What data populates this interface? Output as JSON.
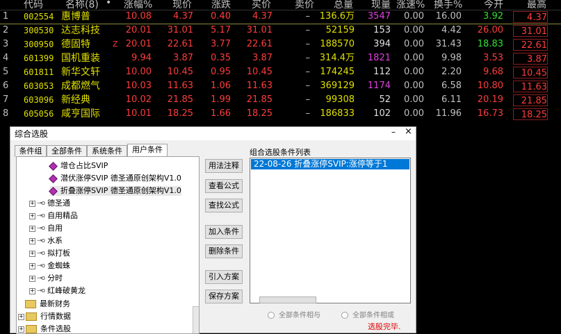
{
  "quote_table": {
    "headers": [
      "代码",
      "名称(8)",
      "•",
      "涨幅%",
      "现价",
      "涨跌",
      "买价",
      "卖价",
      "总量",
      "现量",
      "涨速%",
      "换手%",
      "今开",
      "最高"
    ],
    "rows": [
      {
        "idx": "1",
        "code": "002554",
        "name": "惠博普",
        "mark": "",
        "pct": "10.08",
        "price": "4.37",
        "chg": "0.40",
        "bid": "4.37",
        "ask": "–",
        "vol": "136.6万",
        "cur": "3547",
        "cur_color": "#e040e0",
        "spd": "0.00",
        "turn": "16.00",
        "open": "3.92",
        "open_color": "#30e030",
        "high": "4.37"
      },
      {
        "idx": "2",
        "code": "300530",
        "name": "达志科技",
        "mark": "",
        "pct": "20.01",
        "price": "31.01",
        "chg": "5.17",
        "bid": "31.01",
        "ask": "–",
        "vol": "52159",
        "cur": "153",
        "cur_color": "#e0e0e0",
        "spd": "0.00",
        "turn": "4.42",
        "open": "26.00",
        "open_color": "#ff3c3c",
        "high": "31.01"
      },
      {
        "idx": "3",
        "code": "300950",
        "name": "德固特",
        "mark": "Z",
        "pct": "20.01",
        "price": "22.61",
        "chg": "3.77",
        "bid": "22.61",
        "ask": "–",
        "vol": "188570",
        "cur": "394",
        "cur_color": "#e0e0e0",
        "spd": "0.00",
        "turn": "31.43",
        "open": "18.83",
        "open_color": "#30e030",
        "high": "22.61"
      },
      {
        "idx": "4",
        "code": "601399",
        "name": "国机重装",
        "mark": "",
        "pct": "9.94",
        "price": "3.87",
        "chg": "0.35",
        "bid": "3.87",
        "ask": "–",
        "vol": "314.4万",
        "cur": "1821",
        "cur_color": "#e040e0",
        "spd": "0.00",
        "turn": "9.98",
        "open": "3.53",
        "open_color": "#ff3c3c",
        "high": "3.87"
      },
      {
        "idx": "5",
        "code": "601811",
        "name": "新华文轩",
        "mark": "",
        "pct": "10.00",
        "price": "10.45",
        "chg": "0.95",
        "bid": "10.45",
        "ask": "–",
        "vol": "174245",
        "cur": "112",
        "cur_color": "#e0e0e0",
        "spd": "0.00",
        "turn": "2.20",
        "open": "9.68",
        "open_color": "#ff3c3c",
        "high": "10.45"
      },
      {
        "idx": "6",
        "code": "603053",
        "name": "成都燃气",
        "mark": "",
        "pct": "10.03",
        "price": "11.63",
        "chg": "1.06",
        "bid": "11.63",
        "ask": "–",
        "vol": "369129",
        "cur": "1174",
        "cur_color": "#e040e0",
        "spd": "0.00",
        "turn": "6.58",
        "open": "10.80",
        "open_color": "#ff3c3c",
        "high": "11.63"
      },
      {
        "idx": "7",
        "code": "603096",
        "name": "新经典",
        "mark": "",
        "pct": "10.02",
        "price": "21.85",
        "chg": "1.99",
        "bid": "21.85",
        "ask": "–",
        "vol": "99308",
        "cur": "52",
        "cur_color": "#e0e0e0",
        "spd": "0.00",
        "turn": "6.11",
        "open": "20.19",
        "open_color": "#ff3c3c",
        "high": "21.85"
      },
      {
        "idx": "8",
        "code": "605056",
        "name": "咸亨国际",
        "mark": "",
        "pct": "10.01",
        "price": "18.25",
        "chg": "1.66",
        "bid": "18.25",
        "ask": "–",
        "vol": "186833",
        "cur": "102",
        "cur_color": "#e0e0e0",
        "spd": "0.00",
        "turn": "11.96",
        "open": "16.73",
        "open_color": "#ff3c3c",
        "high": "18.25"
      }
    ]
  },
  "dialog": {
    "title": "综合选股",
    "minimize": "–",
    "close": "×",
    "tabs": [
      "条件组",
      "全部条件",
      "系统条件",
      "用户条件"
    ],
    "tree": [
      {
        "type": "formula",
        "label": "增仓占比SVIP"
      },
      {
        "type": "formula",
        "label": "潜伏涨停SVIP 德圣通原创架构V1.0"
      },
      {
        "type": "formula",
        "label": "折叠涨停SVIP 德圣通原创架构V1.0"
      },
      {
        "type": "group",
        "label": "德圣通"
      },
      {
        "type": "group",
        "label": "自用精品"
      },
      {
        "type": "group",
        "label": "自用"
      },
      {
        "type": "group",
        "label": "水系"
      },
      {
        "type": "group",
        "label": "拟打板"
      },
      {
        "type": "group",
        "label": "金蜘蛛"
      },
      {
        "type": "group",
        "label": "分时"
      },
      {
        "type": "group",
        "label": "红峰破黄龙"
      },
      {
        "type": "folder",
        "label": "最新财务"
      },
      {
        "type": "folder",
        "label": "行情数据"
      },
      {
        "type": "folder",
        "label": "条件选股"
      }
    ],
    "buttons": {
      "usage": "用法注释",
      "view": "查看公式",
      "find": "查找公式",
      "add": "加入条件",
      "delete": "删除条件",
      "import": "引入方案",
      "save": "保存方案"
    },
    "list_label": "组合选股条件列表",
    "list_items": [
      "22-08-26 折叠涨停SVIP:涨停等于1"
    ],
    "radio_and": "全部条件相与",
    "radio_or": "全部条件相或",
    "status": "选股完毕."
  }
}
